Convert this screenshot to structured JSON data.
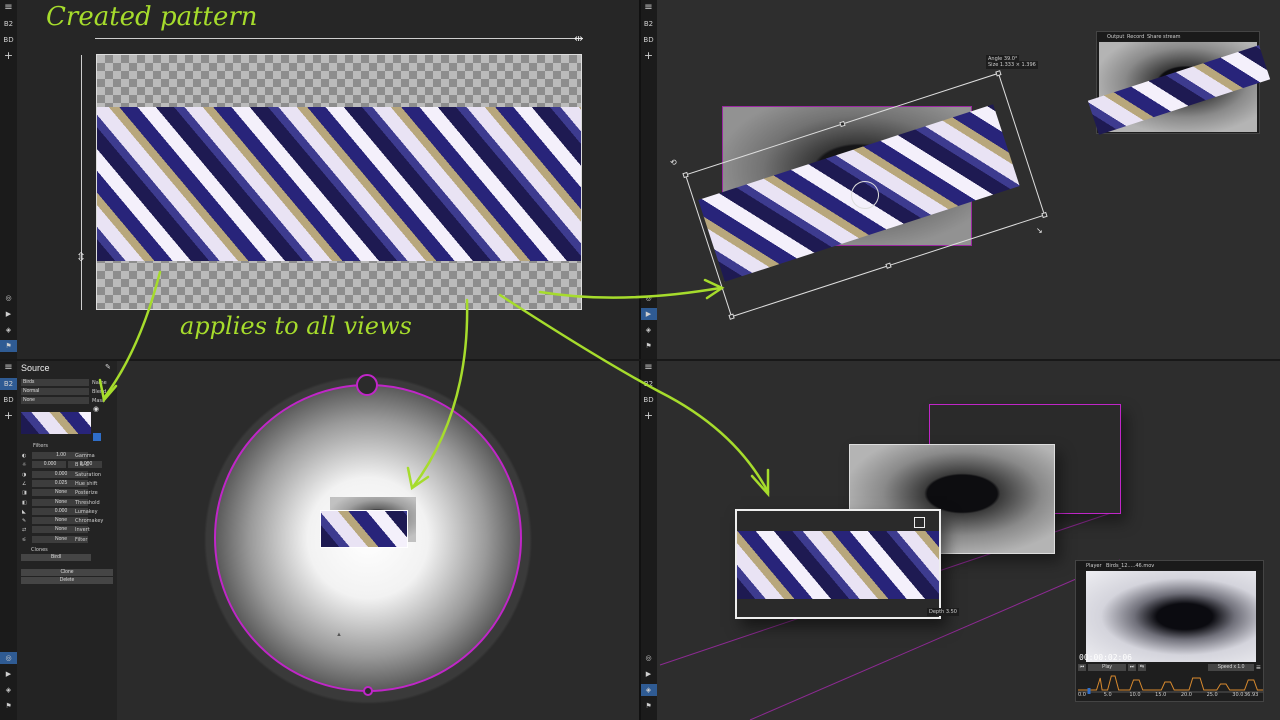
{
  "rail": {
    "menu": "≡",
    "b2": "B2",
    "bd": "BD",
    "add": "+"
  },
  "annotations": {
    "created_pattern": "Created pattern",
    "applies": "applies to all views"
  },
  "view3d": {
    "angle": "Angle 39.0°",
    "size": "Size 1.333 × 1.396"
  },
  "output_panel": {
    "output": "Output",
    "record": "Record",
    "share": "Share stream"
  },
  "source_panel": {
    "title": "Source",
    "name_value": "Birds",
    "name_label": "Name",
    "blend_value": "Normal",
    "blend_label": "Blend",
    "mask_value": "None",
    "mask_label": "Mask",
    "filters_label": "Filters",
    "filters": [
      {
        "value": "1.00",
        "label": "Gamma"
      },
      {
        "value_a": "0.000",
        "value_b": "0.000",
        "label": "B & C"
      },
      {
        "value": "0.000",
        "label": "Saturation"
      },
      {
        "value": "0.025",
        "label": "Hue shift"
      },
      {
        "value": "None",
        "label": "Posterize"
      },
      {
        "value": "None",
        "label": "Threshold"
      },
      {
        "value": "0.000",
        "label": "Lumakey"
      },
      {
        "value": "None",
        "label": "Chromakey"
      },
      {
        "value": "None",
        "label": "Invert"
      },
      {
        "value": "None",
        "label": "Filter"
      }
    ],
    "clones_label": "Clones",
    "clone_item": "Birdl",
    "clone_button": "Clone",
    "delete_button": "Delete"
  },
  "depth_label": "Depth 3.50",
  "player": {
    "title": "Player",
    "file": "Birds_12.....46.mov",
    "timecode": "00:00:02:06",
    "play": "Play",
    "speed": "Speed x 1.0",
    "ticks": [
      "0.0",
      "5.0",
      "10.0",
      "15.0",
      "20.0",
      "25.0",
      "30.0",
      "36.93"
    ],
    "speed_ctrl": {
      "min": 0,
      "max": 36.93,
      "current": 2.2
    },
    "curve": [
      [
        0,
        0.9
      ],
      [
        0.1,
        0.9
      ],
      [
        0.12,
        0.3
      ],
      [
        0.13,
        0.9
      ],
      [
        0.16,
        0.9
      ],
      [
        0.18,
        0.2
      ],
      [
        0.2,
        0.2
      ],
      [
        0.22,
        0.9
      ],
      [
        0.28,
        0.9
      ],
      [
        0.3,
        0.4
      ],
      [
        0.33,
        0.4
      ],
      [
        0.35,
        0.9
      ],
      [
        0.45,
        0.9
      ],
      [
        0.47,
        0.5
      ],
      [
        0.5,
        0.5
      ],
      [
        0.52,
        0.9
      ],
      [
        0.6,
        0.9
      ],
      [
        0.62,
        0.3
      ],
      [
        0.66,
        0.3
      ],
      [
        0.68,
        0.9
      ],
      [
        0.75,
        0.9
      ],
      [
        0.77,
        0.6
      ],
      [
        0.8,
        0.6
      ],
      [
        0.82,
        0.9
      ],
      [
        0.9,
        0.9
      ],
      [
        0.92,
        0.4
      ],
      [
        0.95,
        0.4
      ],
      [
        0.97,
        0.9
      ],
      [
        1,
        0.9
      ]
    ]
  },
  "colors": {
    "annotation": "#a6dc2c",
    "magenta": "#c026c8",
    "rail_active": "#2f5b93",
    "curve": "#d98a2e"
  },
  "icons": [
    "menu-icon",
    "plus-icon",
    "target-icon",
    "layers-icon",
    "flag-icon",
    "video-icon",
    "eye-icon",
    "pin-icon",
    "link-icon",
    "scale-icon",
    "rotate-icon"
  ]
}
